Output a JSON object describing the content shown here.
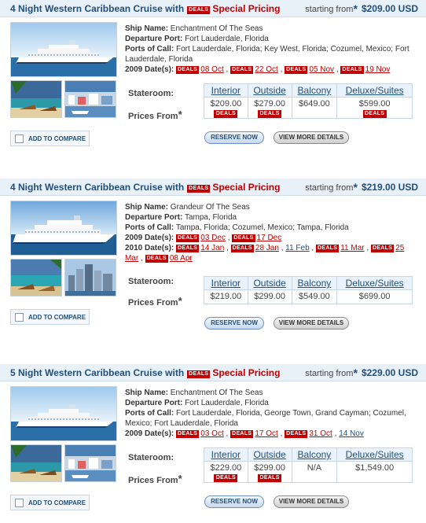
{
  "labels": {
    "deals": "DEALS",
    "special_pricing": "Special Pricing",
    "starting_from": "starting from",
    "star": "*",
    "ship_name": "Ship Name:",
    "departure_port": "Departure Port:",
    "ports_of_call": "Ports of Call:",
    "stateroom": "Stateroom:",
    "prices_from": "Prices From",
    "add_to_compare": "ADD TO COMPARE",
    "reserve_now": "RESERVE NOW",
    "view_more_details": "VIEW MORE DETAILS",
    "columns": [
      "Interior",
      "Outside",
      "Balcony",
      "Deluxe/Suites"
    ]
  },
  "colors": {
    "link_blue": "#21507c",
    "deal_red": "#c00000",
    "header_bg": "#e8f0f8"
  },
  "listings": [
    {
      "title": "4 Night Western Caribbean Cruise with",
      "price": "$209.00 USD",
      "ship": "Enchantment Of The Seas",
      "departure": "Fort Lauderdale, Florida",
      "ports": "Fort Lauderdale, Florida; Key West, Florida; Cozumel, Mexico; Fort Lauderdale, Florida",
      "date_groups": [
        {
          "label": "2009 Date(s):",
          "dates": [
            {
              "text": "08 Oct",
              "deal": true
            },
            {
              "text": "22 Oct",
              "deal": true
            },
            {
              "text": "05 Nov",
              "deal": true
            },
            {
              "text": "19 Nov",
              "deal": true
            }
          ]
        }
      ],
      "prices": [
        {
          "value": "$209.00",
          "deal": true
        },
        {
          "value": "$279.00",
          "deal": true
        },
        {
          "value": "$649.00",
          "deal": false
        },
        {
          "value": "$599.00",
          "deal": true
        }
      ]
    },
    {
      "title": "4 Night Western Caribbean Cruise with",
      "price": "$219.00 USD",
      "ship": "Grandeur Of The Seas",
      "departure": "Tampa, Florida",
      "ports": "Tampa, Florida; Cozumel, Mexico; Tampa, Florida",
      "date_groups": [
        {
          "label": "2009 Date(s):",
          "dates": [
            {
              "text": "03 Dec",
              "deal": true
            },
            {
              "text": "17 Dec",
              "deal": true
            }
          ]
        },
        {
          "label": "2010 Date(s):",
          "dates": [
            {
              "text": "14 Jan",
              "deal": true
            },
            {
              "text": "28 Jan",
              "deal": true
            },
            {
              "text": "11 Feb",
              "deal": false
            },
            {
              "text": "11 Mar",
              "deal": true
            },
            {
              "text": "25 Mar",
              "deal": true
            },
            {
              "text": "08 Apr",
              "deal": true
            }
          ]
        }
      ],
      "prices": [
        {
          "value": "$219.00",
          "deal": false
        },
        {
          "value": "$299.00",
          "deal": false
        },
        {
          "value": "$549.00",
          "deal": false
        },
        {
          "value": "$699.00",
          "deal": false
        }
      ]
    },
    {
      "title": "5 Night Western Caribbean Cruise with",
      "price": "$229.00 USD",
      "ship": "Enchantment Of The Seas",
      "departure": "Fort Lauderdale, Florida",
      "ports": "Fort Lauderdale, Florida, George Town, Grand Cayman; Cozumel, Mexico; Fort Lauderdale, Florida",
      "date_groups": [
        {
          "label": "2009 Date(s):",
          "dates": [
            {
              "text": "03 Oct",
              "deal": true
            },
            {
              "text": "17 Oct",
              "deal": true
            },
            {
              "text": "31 Oct",
              "deal": true
            },
            {
              "text": "14 Nov",
              "deal": false
            }
          ]
        }
      ],
      "prices": [
        {
          "value": "$229.00",
          "deal": true
        },
        {
          "value": "$299.00",
          "deal": true
        },
        {
          "value": "N/A",
          "deal": false
        },
        {
          "value": "$1,549.00",
          "deal": false
        }
      ]
    }
  ]
}
